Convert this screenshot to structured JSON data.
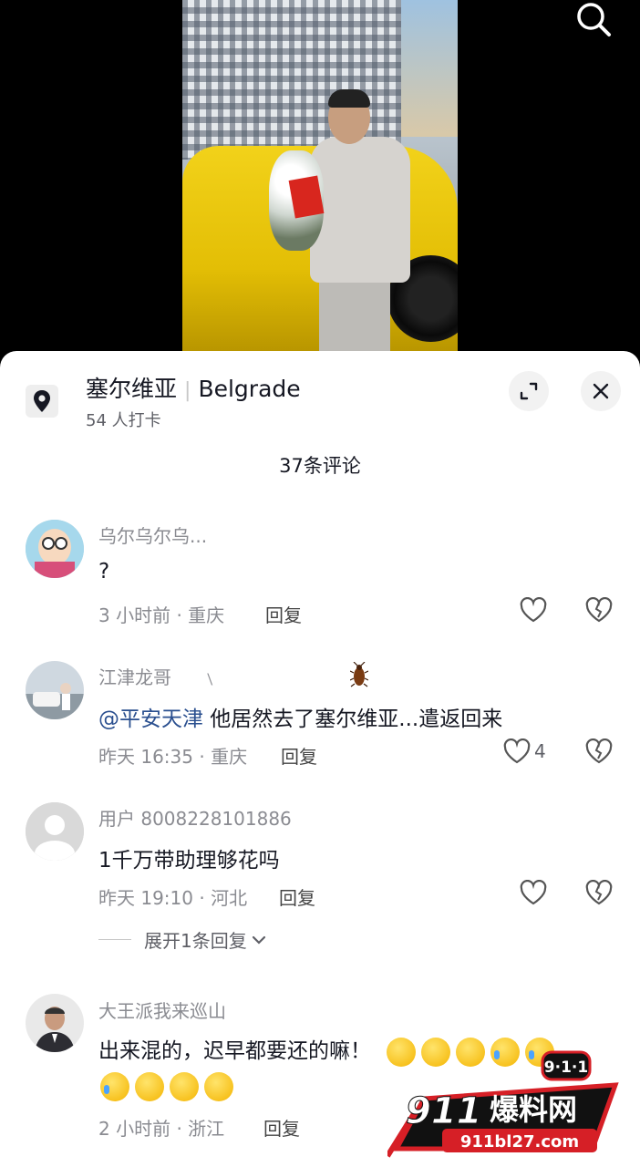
{
  "location": {
    "name_cn": "塞尔维亚",
    "name_en": "Belgrade",
    "checkins": "54 人打卡"
  },
  "comments_count": "37条评论",
  "reply_label": "回复",
  "comments": [
    {
      "user": "乌尔乌尔乌...",
      "text": "?",
      "meta": "3 小时前 · 重庆",
      "likes": ""
    },
    {
      "user": "江津龙哥",
      "user_decor": "﹨",
      "mention": "@平安天津",
      "text": " 他居然去了塞尔维亚...遣返回来",
      "meta": "昨天 16:35 · 重庆",
      "likes": "4"
    },
    {
      "user": "用户 8008228101886",
      "text": "1千万带助理够花吗",
      "meta": "昨天 19:10 · 河北",
      "likes": "",
      "expand": "展开1条回复"
    },
    {
      "user": "大王派我来巡山",
      "text": "出来混的，迟早都要还的嘛！",
      "meta": "2 小时前 · 浙江",
      "likes": ""
    }
  ],
  "watermark": {
    "top": "9·1·1",
    "main_num": "911",
    "main_cn": "爆料网",
    "domain": "911bl27.com"
  },
  "icons": [
    "search-icon",
    "location-pin-icon",
    "expand-icon",
    "close-icon",
    "heart-icon",
    "broken-heart-icon",
    "chevron-down-icon",
    "cockroach-icon"
  ]
}
